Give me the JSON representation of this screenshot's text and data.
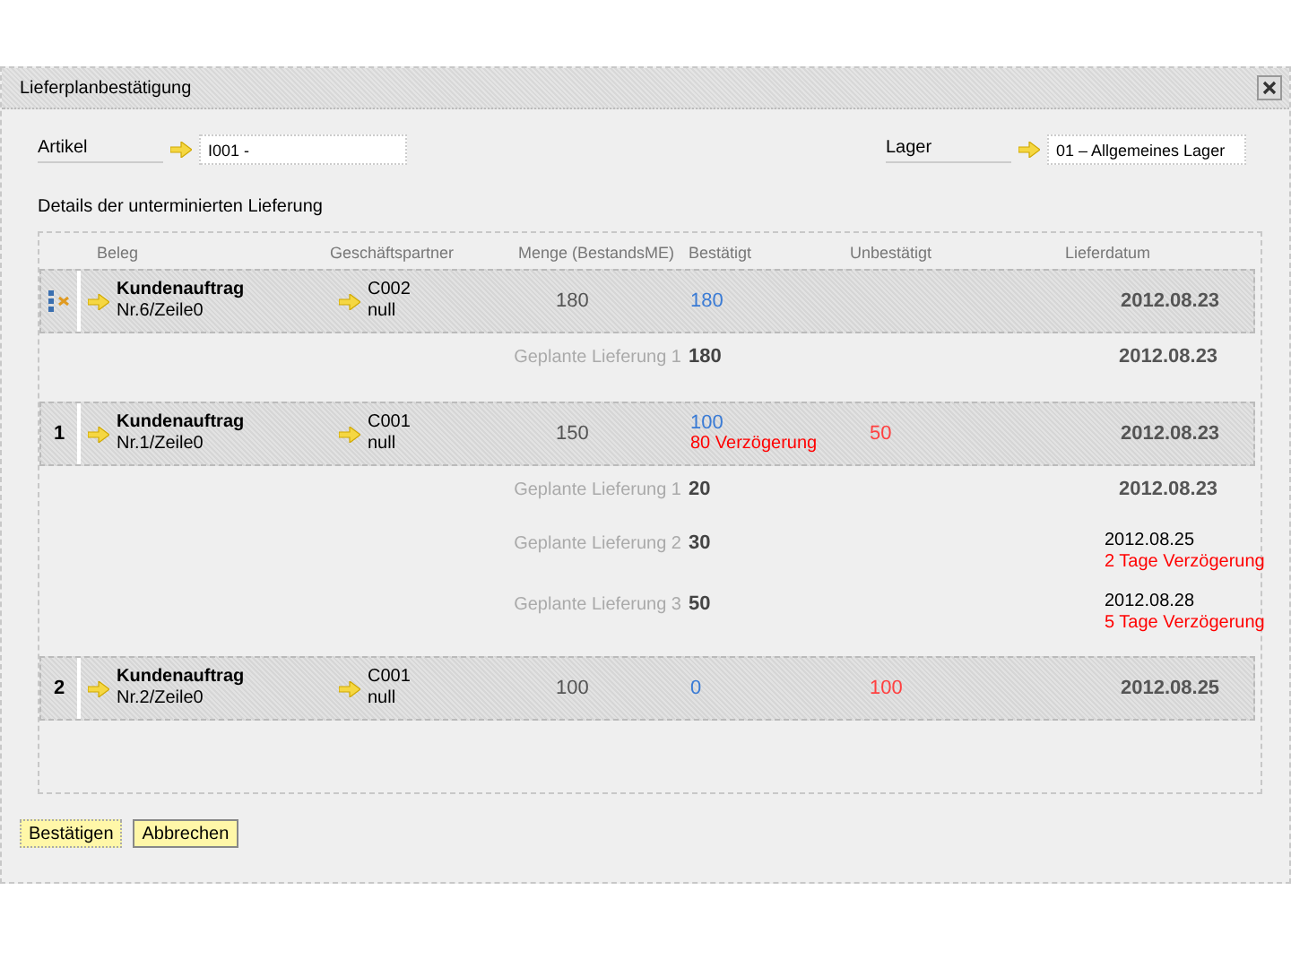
{
  "window": {
    "title": "Lieferplanbestätigung"
  },
  "fields": {
    "artikel": {
      "label": "Artikel",
      "value": "I001 -"
    },
    "lager": {
      "label": "Lager",
      "value": "01 – Allgemeines Lager"
    }
  },
  "section_title": "Details der unterminierten Lieferung",
  "table": {
    "columns": [
      "Beleg",
      "Geschäftspartner",
      "Menge (BestandsME)",
      "Bestätigt",
      "Unbestätigt",
      "Lieferdatum"
    ],
    "orders": [
      {
        "marker": {
          "kind": "icon"
        },
        "beleg_title": "Kundenauftrag",
        "beleg_nr": "Nr.6/Zeile0",
        "partner_code": "C002",
        "partner_sub": "null",
        "menge": "180",
        "bestaetigt": "180",
        "datum": "2012.08.23",
        "deliveries": [
          {
            "label": "Geplante Lieferung 1",
            "menge": "180",
            "datum": "2012.08.23"
          }
        ]
      },
      {
        "marker": {
          "kind": "number",
          "text": "1"
        },
        "beleg_title": "Kundenauftrag",
        "beleg_nr": "Nr.1/Zeile0",
        "partner_code": "C001",
        "partner_sub": "null",
        "menge": "150",
        "bestaetigt": "100",
        "delay": "80 Verzögerung",
        "unbestaetigt": "50",
        "datum": "2012.08.23",
        "deliveries": [
          {
            "label": "Geplante Lieferung 1",
            "menge": "20",
            "datum": "2012.08.23"
          },
          {
            "label": "Geplante Lieferung 2",
            "menge": "30",
            "datum": "2012.08.25",
            "delay": "2 Tage Verzögerung"
          },
          {
            "label": "Geplante Lieferung 3",
            "menge": "50",
            "datum": "2012.08.28",
            "delay": "5 Tage Verzögerung"
          }
        ]
      },
      {
        "marker": {
          "kind": "number",
          "text": "2"
        },
        "beleg_title": "Kundenauftrag",
        "beleg_nr": "Nr.2/Zeile0",
        "partner_code": "C001",
        "partner_sub": "null",
        "menge": "100",
        "bestaetigt": "0",
        "unbestaetigt": "100",
        "datum": "2012.08.25"
      }
    ]
  },
  "buttons": [
    "Bestätigen",
    "Abbrechen"
  ]
}
